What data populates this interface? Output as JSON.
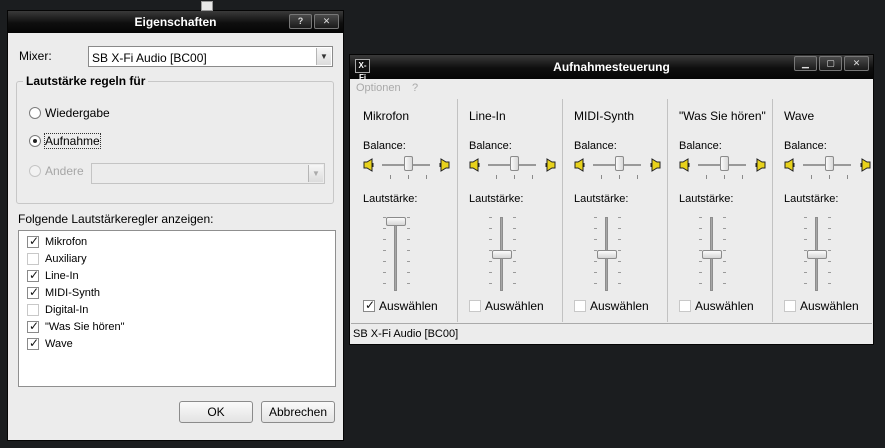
{
  "properties_dialog": {
    "title": "Eigenschaften",
    "mixer_label": "Mixer:",
    "mixer_value": "SB X-Fi Audio [BC00]",
    "group_title": "Lautstärke regeln für",
    "radio_playback": "Wiedergabe",
    "radio_record": "Aufnahme",
    "radio_other": "Andere",
    "selected_mode": "Aufnahme",
    "list_label": "Folgende Lautstärkeregler anzeigen:",
    "controls": [
      {
        "label": "Mikrofon",
        "checked": true
      },
      {
        "label": "Auxiliary",
        "checked": false
      },
      {
        "label": "Line-In",
        "checked": true
      },
      {
        "label": "MIDI-Synth",
        "checked": true
      },
      {
        "label": "Digital-In",
        "checked": false
      },
      {
        "label": "\"Was Sie hören\"",
        "checked": true
      },
      {
        "label": "Wave",
        "checked": true
      }
    ],
    "ok_label": "OK",
    "cancel_label": "Abbrechen"
  },
  "recording_window": {
    "title": "Aufnahmesteuerung",
    "menu": [
      "Optionen",
      "?"
    ],
    "balance_label": "Balance:",
    "volume_label": "Lautstärke:",
    "select_label": "Auswählen",
    "channels": [
      {
        "name": "Mikrofon",
        "selected": true,
        "balance": 0.5,
        "volume": 1.0
      },
      {
        "name": "Line-In",
        "selected": false,
        "balance": 0.5,
        "volume": 0.5
      },
      {
        "name": "MIDI-Synth",
        "selected": false,
        "balance": 0.5,
        "volume": 0.5
      },
      {
        "name": "\"Was Sie hören\"",
        "selected": false,
        "balance": 0.5,
        "volume": 0.5
      },
      {
        "name": "Wave",
        "selected": false,
        "balance": 0.5,
        "volume": 0.5
      }
    ],
    "status": "SB X-Fi Audio [BC00]"
  }
}
